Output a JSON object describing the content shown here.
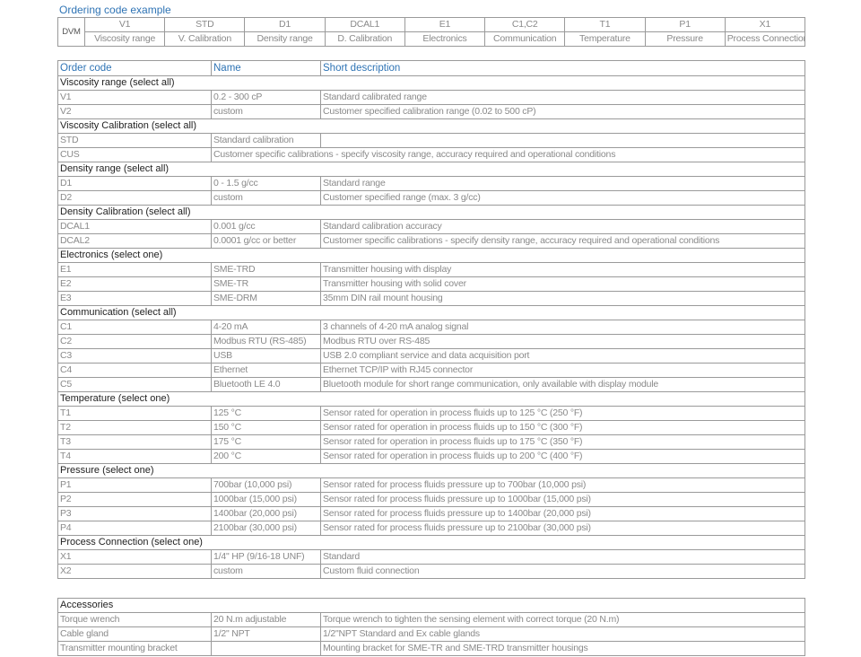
{
  "example": {
    "title": "Ordering code example",
    "prefix": "DVM",
    "codes": [
      "V1",
      "STD",
      "D1",
      "DCAL1",
      "E1",
      "C1,C2",
      "T1",
      "P1",
      "X1"
    ],
    "names": [
      "Viscosity range",
      "V. Calibration",
      "Density range",
      "D. Calibration",
      "Electronics",
      "Communication",
      "Temperature",
      "Pressure",
      "Process Connection"
    ]
  },
  "table": {
    "headers": [
      "Order code",
      "Name",
      "Short description"
    ],
    "sections": [
      {
        "title": "Viscosity range (select all)",
        "rows": [
          [
            "V1",
            "0.2 - 300 cP",
            "Standard calibrated range"
          ],
          [
            "V2",
            "custom",
            "Customer specified calibration range (0.02 to 500 cP)"
          ]
        ]
      },
      {
        "title": "Viscosity Calibration (select all)",
        "rows": [
          [
            "STD",
            "Standard calibration",
            ""
          ],
          [
            "CUS",
            "Customer specific calibrations - specify viscosity range, accuracy required and operational conditions",
            ""
          ]
        ]
      },
      {
        "title": "Density range (select all)",
        "rows": [
          [
            "D1",
            "0 - 1.5 g/cc",
            "Standard range"
          ],
          [
            "D2",
            "custom",
            "Customer specified range  (max. 3 g/cc)"
          ]
        ]
      },
      {
        "title": "Density Calibration (select all)",
        "rows": [
          [
            "DCAL1",
            "0.001 g/cc",
            "Standard calibration accuracy"
          ],
          [
            "DCAL2",
            "0.0001 g/cc or better",
            "Customer specific calibrations - specify density range, accuracy required and operational conditions"
          ]
        ]
      },
      {
        "title": "Electronics (select one)",
        "rows": [
          [
            "E1",
            "SME-TRD",
            "Transmitter housing with display"
          ],
          [
            "E2",
            "SME-TR",
            "Transmitter housing with solid cover"
          ],
          [
            "E3",
            "SME-DRM",
            "35mm DIN rail mount housing"
          ]
        ]
      },
      {
        "title": "Communication (select all)",
        "rows": [
          [
            "C1",
            "4-20 mA",
            "3 channels of 4-20 mA analog signal"
          ],
          [
            "C2",
            "Modbus RTU (RS-485)",
            "Modbus RTU over RS-485"
          ],
          [
            "C3",
            "USB",
            "USB 2.0 compliant service and data acquisition port"
          ],
          [
            "C4",
            "Ethernet",
            "Ethernet TCP/IP with RJ45 connector"
          ],
          [
            "C5",
            "Bluetooth LE 4.0",
            "Bluetooth module for short range communication, only available with display module"
          ]
        ]
      },
      {
        "title": "Temperature (select one)",
        "rows": [
          [
            "T1",
            "125 °C",
            "Sensor rated for operation in process fluids up to 125 °C (250 °F)"
          ],
          [
            "T2",
            "150 °C",
            "Sensor rated for operation in process fluids up to 150 °C (300 °F)"
          ],
          [
            "T3",
            "175 °C",
            "Sensor rated for operation in process fluids up to 175 °C (350 °F)"
          ],
          [
            "T4",
            "200 °C",
            "Sensor rated for operation in process fluids up to 200 °C (400 °F)"
          ]
        ]
      },
      {
        "title": "Pressure (select one)",
        "rows": [
          [
            "P1",
            "700bar (10,000 psi)",
            "Sensor rated for process fluids pressure up to 700bar (10,000 psi)"
          ],
          [
            "P2",
            "1000bar (15,000 psi)",
            "Sensor rated for process fluids pressure up to 1000bar (15,000 psi)"
          ],
          [
            "P3",
            "1400bar (20,000 psi)",
            "Sensor rated for process fluids pressure up to 1400bar (20,000 psi)"
          ],
          [
            "P4",
            "2100bar (30,000 psi)",
            "Sensor rated for process fluids pressure up to 2100bar (30,000 psi)"
          ]
        ]
      },
      {
        "title": "Process Connection (select one)",
        "rows": [
          [
            "X1",
            "1/4\" HP (9/16-18 UNF)",
            "Standard"
          ],
          [
            "X2",
            "custom",
            "Custom fluid connection"
          ]
        ]
      }
    ]
  },
  "accessories": {
    "title": "Accessories",
    "rows": [
      [
        "Torque wrench",
        "20 N.m adjustable",
        "Torque wrench to tighten the sensing element with correct torque (20 N.m)"
      ],
      [
        "Cable gland",
        "1/2\" NPT",
        "1/2\"NPT Standard and Ex cable glands"
      ],
      [
        "Transmitter mounting bracket",
        "",
        "Mounting bracket for SME-TR and SME-TRD transmitter housings"
      ]
    ]
  },
  "colors": {
    "accent": "#2f74b5",
    "border": "#9a9a9a",
    "text": "#8a8a8a",
    "section_text": "#222222"
  }
}
